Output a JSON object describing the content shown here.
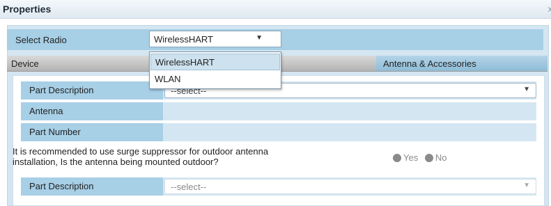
{
  "panel": {
    "title": "Properties",
    "close_glyph": "x"
  },
  "select_radio": {
    "label": "Select Radio",
    "value": "WirelessHART",
    "options": [
      "WirelessHART",
      "WLAN"
    ]
  },
  "tabs": {
    "device": "Device",
    "antenna": "Antenna & Accessories"
  },
  "rows": {
    "part_description": "Part Description",
    "antenna": "Antenna",
    "part_number": "Part Number",
    "part_description_2": "Part Description"
  },
  "fields": {
    "part_description_placeholder": "--select--",
    "part_description_2_placeholder": "--select--"
  },
  "question": {
    "line1": "It is recommended to use surge suppressor for outdoor antenna",
    "line2": "installation, Is the antenna being mounted outdoor?",
    "yes": "Yes",
    "no": "No"
  },
  "icons": {
    "dropdown_arrow": "chevron-down-icon",
    "radio": "radio-button-icon"
  },
  "colors": {
    "row_label_bg": "#a7cfe6",
    "row_bg": "#d4e6f1",
    "tab_active": "#8fbcd7"
  }
}
